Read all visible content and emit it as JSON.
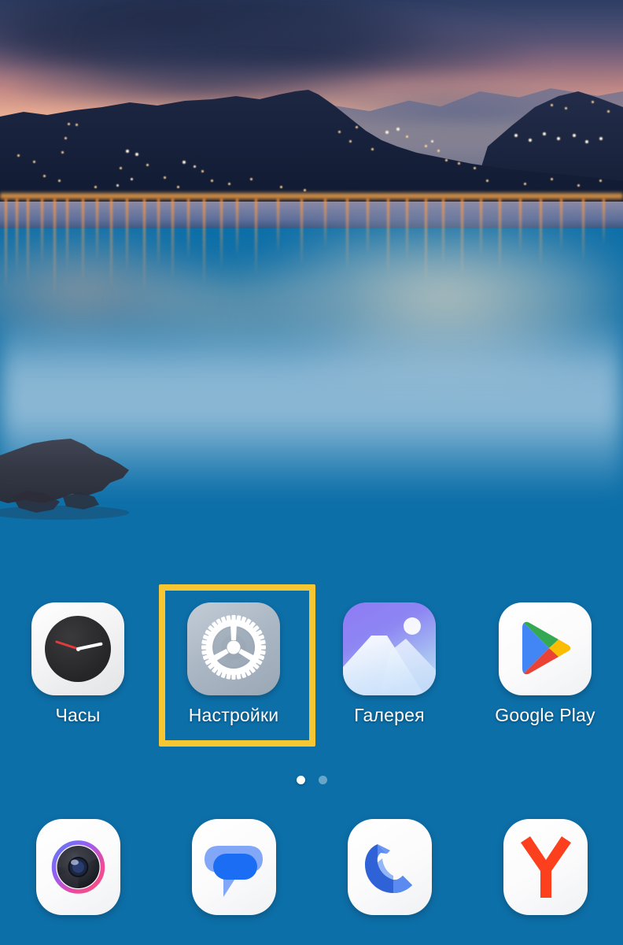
{
  "device": {
    "platform": "android-home-screen",
    "wallpaper_description": "Twilight lake with mountain silhouettes, city lights and misty water"
  },
  "highlight": {
    "target": "Настройки",
    "color": "#f6c732",
    "visible": true
  },
  "home_screen": {
    "apps": [
      {
        "label": "Часы",
        "icon": "clock-icon"
      },
      {
        "label": "Настройки",
        "icon": "gear-icon"
      },
      {
        "label": "Галерея",
        "icon": "gallery-icon"
      },
      {
        "label": "Google Play",
        "icon": "google-play-icon"
      }
    ]
  },
  "page_indicator": {
    "count": 2,
    "active_index": 0
  },
  "dock": {
    "apps": [
      {
        "label": "Камера",
        "icon": "camera-icon"
      },
      {
        "label": "Сообщения",
        "icon": "messages-icon"
      },
      {
        "label": "Телефон",
        "icon": "phone-icon"
      },
      {
        "label": "Яндекс",
        "icon": "yandex-browser-icon"
      }
    ]
  },
  "colors": {
    "highlight": "#f6c732",
    "label_text": "#ffffff",
    "water_bottom": "#0c4e7c",
    "settings_tile": "#aab6c3",
    "yandex_red": "#fc3f1d",
    "play_green": "#34a853",
    "play_blue": "#4285f4",
    "play_yellow": "#fbbc04",
    "play_red": "#ea4335",
    "messages_blue": "#1b6ef3"
  }
}
